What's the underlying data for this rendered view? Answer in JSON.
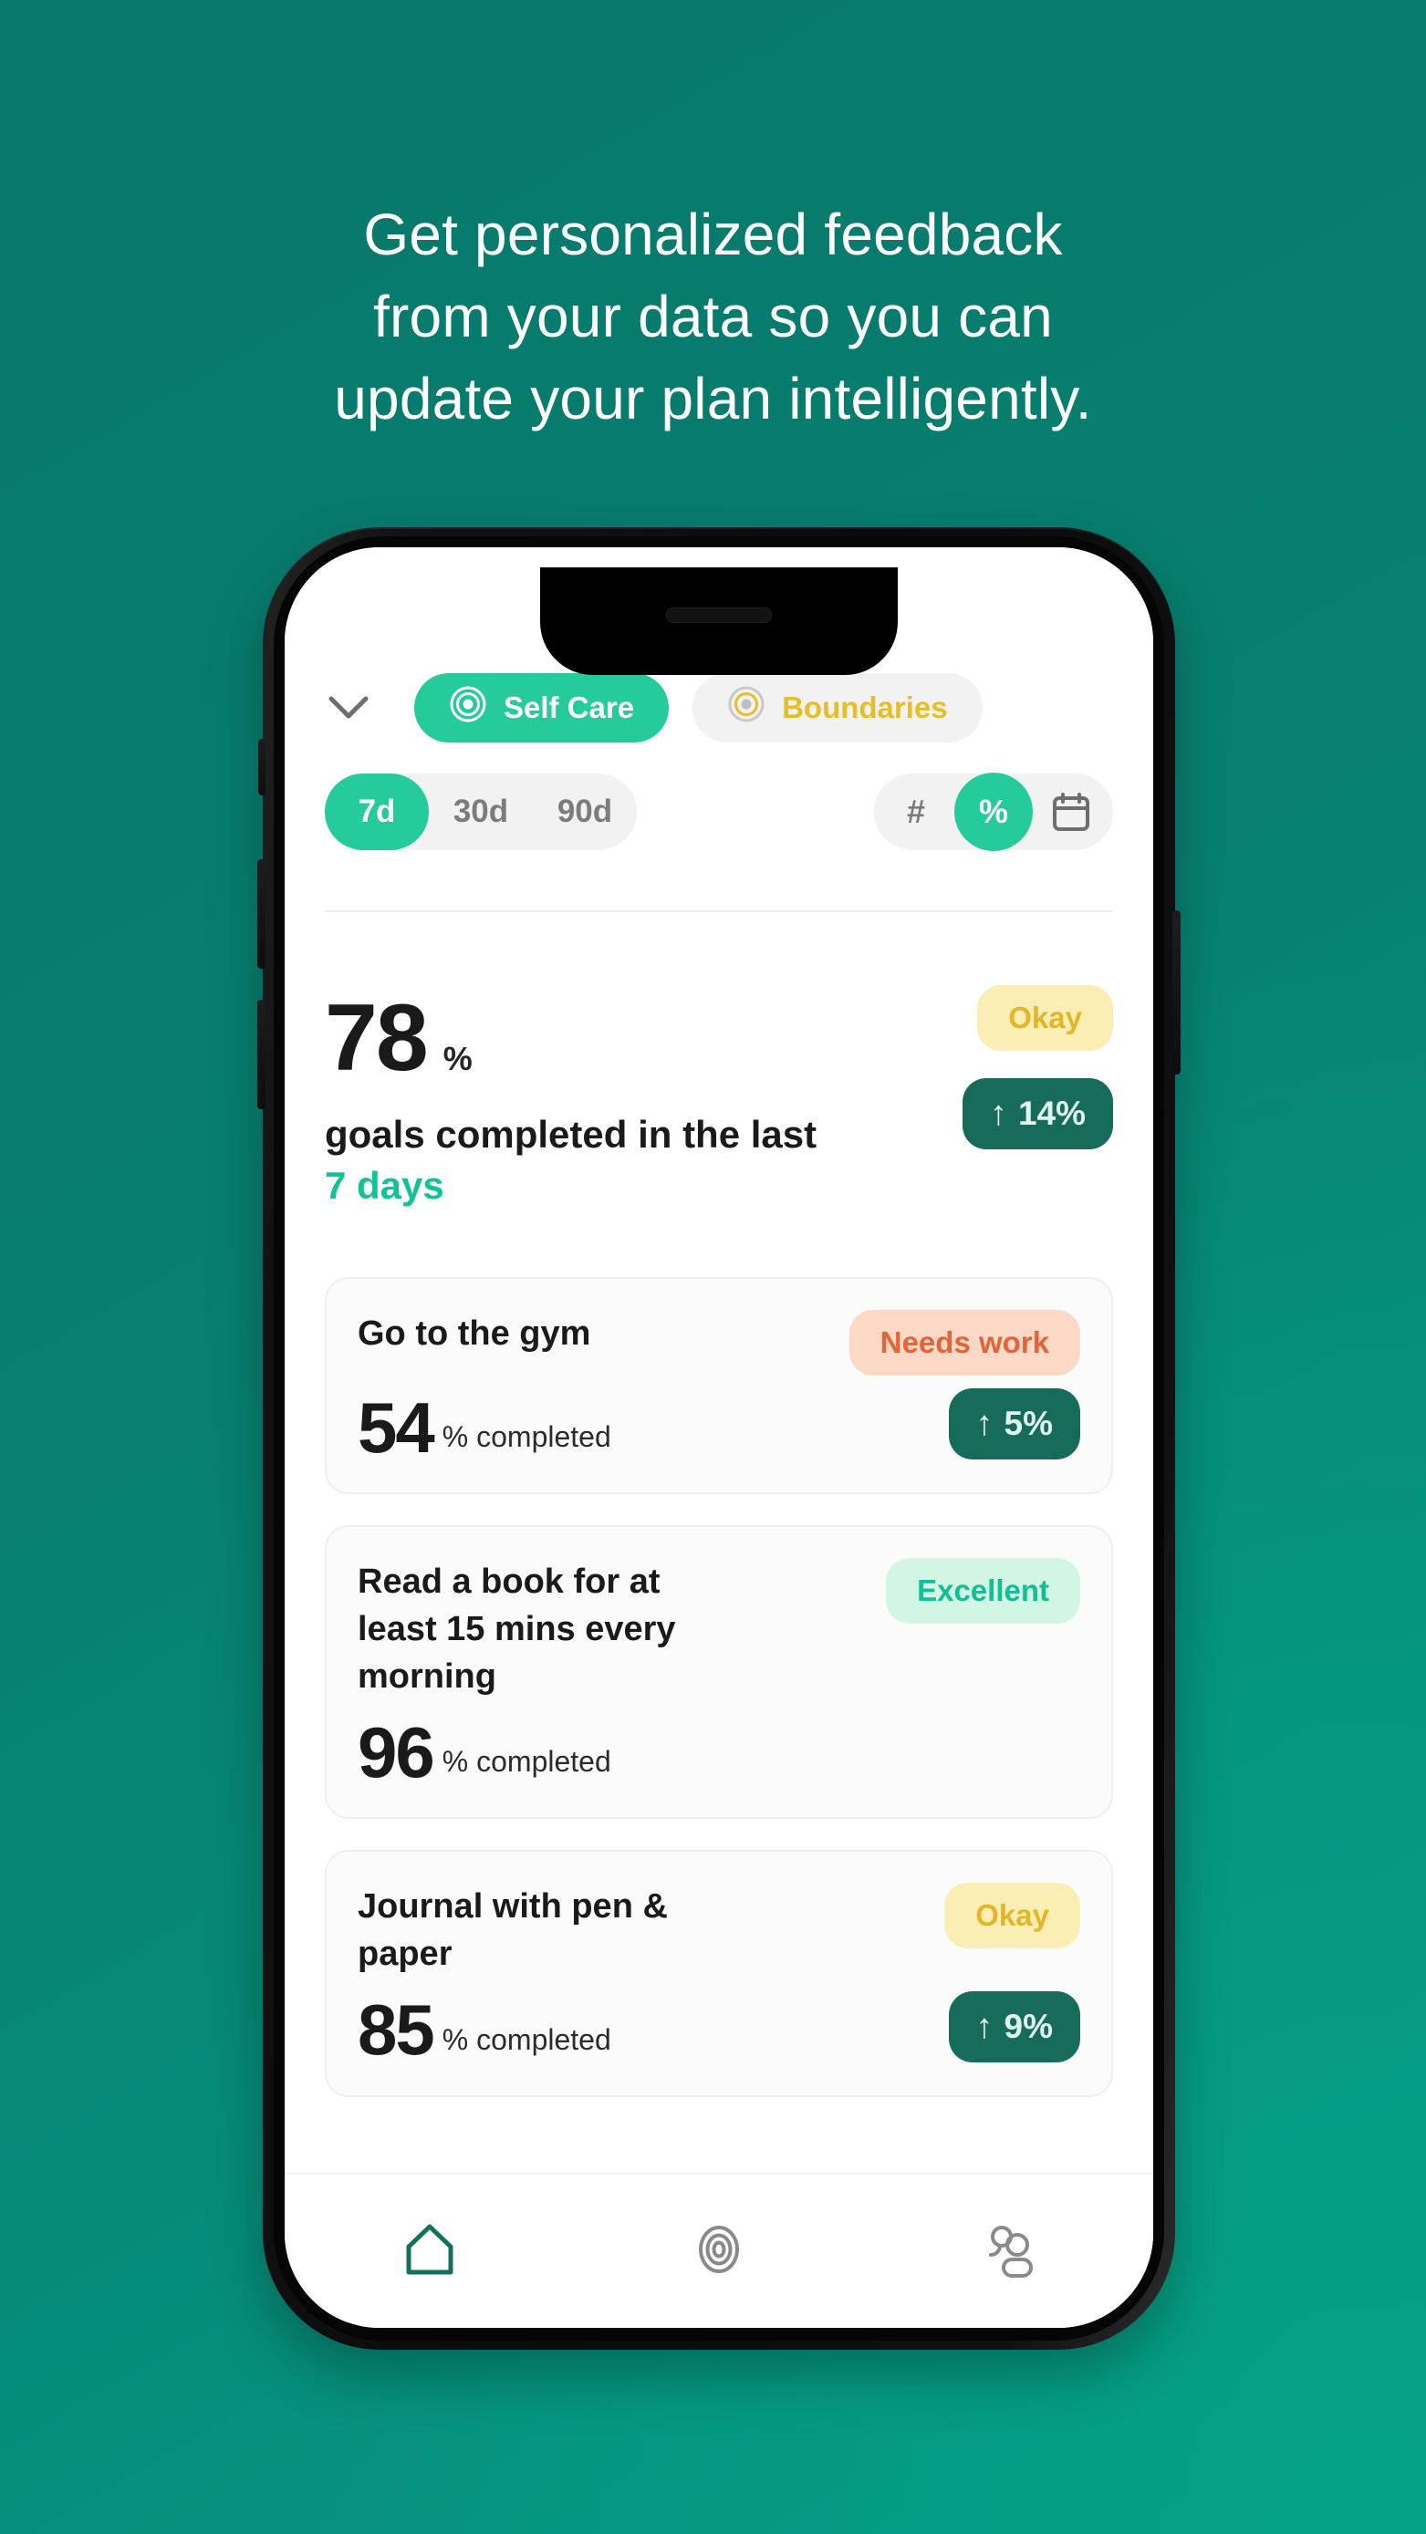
{
  "headline": {
    "lines": [
      "Get personalized feedback",
      "from your data so you can",
      "update your plan intelligently."
    ]
  },
  "colors": {
    "background_top": "#077A6C",
    "background_bottom": "#059985",
    "accent_green": "#25CB9B",
    "accent_green_text": "#12C398",
    "trend_dark_green": "#176B5B",
    "okay_bg": "#FAEEB4",
    "okay_text": "#E2B626",
    "needs_work_bg": "#FCD9C6",
    "needs_work_text": "#E2653A",
    "excellent_bg": "#D3F6E4",
    "excellent_text": "#13BE94"
  },
  "app": {
    "collapse_icon": "chevron-down-icon",
    "tabs": [
      {
        "label": "Self Care",
        "icon": "target-icon",
        "active": true
      },
      {
        "label": "Boundaries",
        "icon": "target-icon",
        "active": false
      }
    ],
    "range_filter": {
      "options": [
        "7d",
        "30d",
        "90d"
      ],
      "selected": "7d"
    },
    "unit_filter": {
      "options": [
        "#",
        "%"
      ],
      "selected": "%",
      "calendar_icon": "calendar-icon"
    },
    "summary": {
      "value": "78",
      "unit": "%",
      "caption_prefix": "goals completed in the last ",
      "caption_accent": "7 days",
      "status_badge": "Okay",
      "status_kind": "okay",
      "trend_arrow": "↑",
      "trend_value": "14%"
    },
    "goals": [
      {
        "title": "Go to the gym",
        "value": "54",
        "unit": "% completed",
        "status_badge": "Needs work",
        "status_kind": "needs",
        "trend_arrow": "↑",
        "trend_value": "5%",
        "has_trend": true
      },
      {
        "title": "Read a book for at least 15 mins every morning",
        "value": "96",
        "unit": "% completed",
        "status_badge": "Excellent",
        "status_kind": "excellent",
        "trend_arrow": "",
        "trend_value": "",
        "has_trend": false
      },
      {
        "title": "Journal with pen & paper",
        "value": "85",
        "unit": "% completed",
        "status_badge": "Okay",
        "status_kind": "okay",
        "trend_arrow": "↑",
        "trend_value": "9%",
        "has_trend": true
      }
    ],
    "bottom_nav": [
      {
        "name": "home-icon",
        "active": true
      },
      {
        "name": "target-icon",
        "active": false
      },
      {
        "name": "people-icon",
        "active": false
      }
    ]
  }
}
